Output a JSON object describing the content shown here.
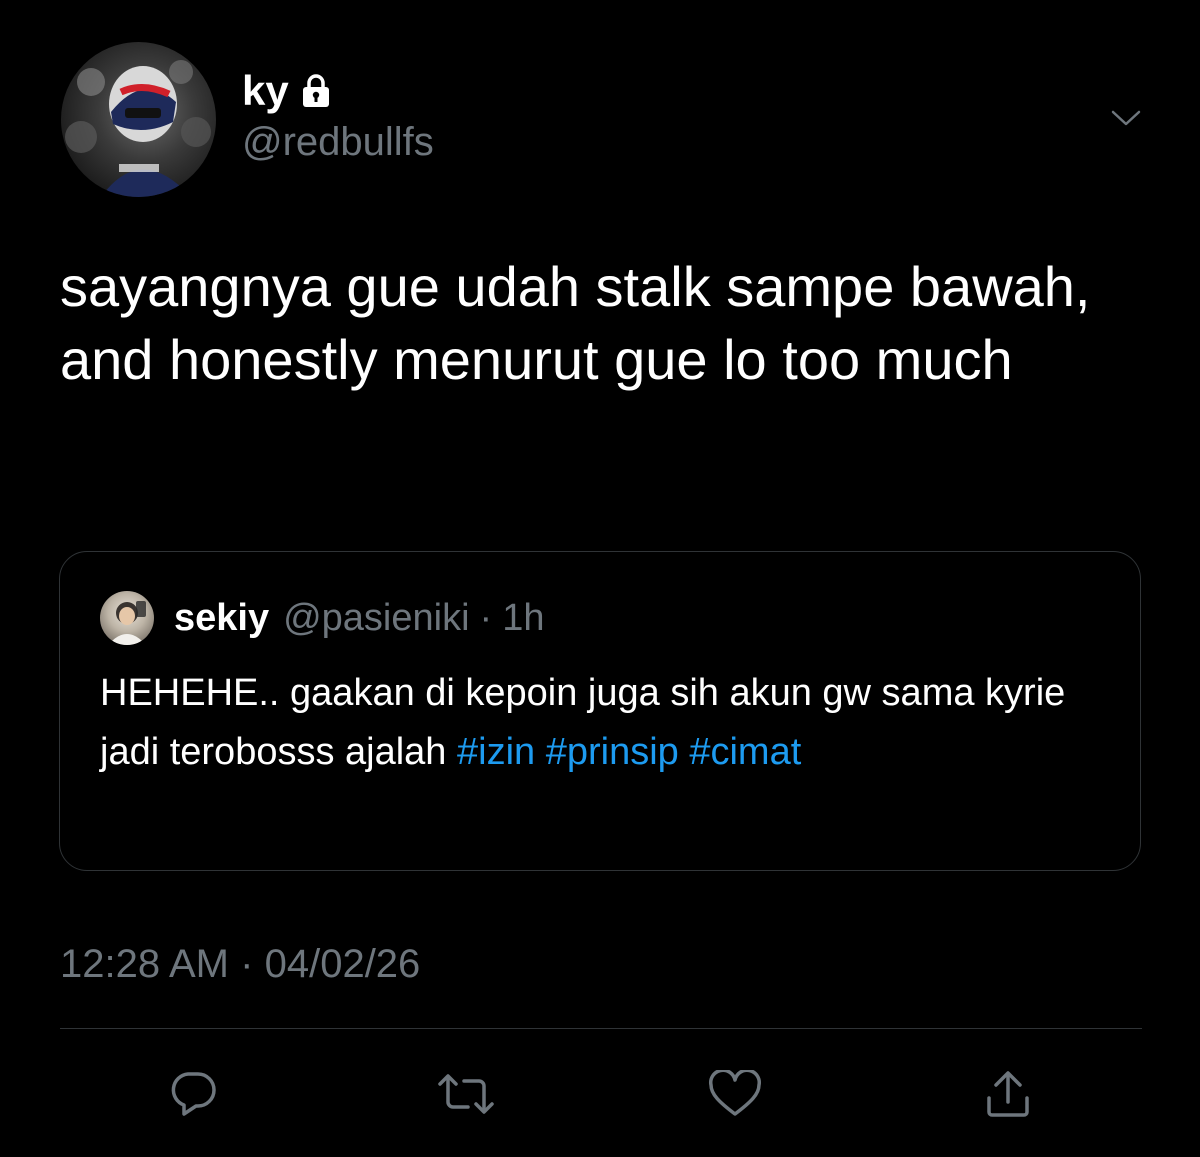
{
  "author": {
    "display_name": "ky",
    "handle": "@redbullfs",
    "verified_icon": "lock-icon",
    "avatar_icon": "avatar-icon"
  },
  "tweet": {
    "text": "sayangnya gue udah stalk sampe bawah, and honestly menurut gue lo too much",
    "time": "12:28 AM",
    "separator": "·",
    "date": "04/02/26"
  },
  "quoted_tweet": {
    "display_name": "sekiy",
    "handle": "@pasieniki",
    "separator": "·",
    "time": "1h",
    "text_plain": "HEHEHE.. gaakan di kepoin juga sih akun gw sama kyrie jadi terobosss ajalah ",
    "hashtags": [
      "#izin",
      "#prinsip",
      "#cimat"
    ],
    "hashtag_color": "#1d9bf0"
  },
  "actions": {
    "reply_icon": "reply-icon",
    "retweet_icon": "retweet-icon",
    "like_icon": "heart-icon",
    "share_icon": "share-icon",
    "more_icon": "chevron-down-icon"
  },
  "colors": {
    "background": "#000000",
    "text_primary": "#ffffff",
    "text_secondary": "#6e767d",
    "border": "#2f3336",
    "accent": "#1d9bf0"
  }
}
